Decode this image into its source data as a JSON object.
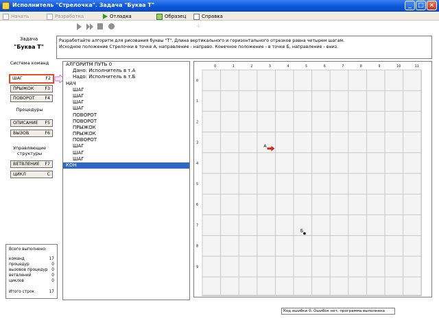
{
  "window": {
    "title": "Исполнитель \"Стрелочка\". Задача \"Буква Т\"",
    "controls": [
      "_",
      "□",
      "×"
    ]
  },
  "menu": [
    {
      "label": "Начать",
      "icon": "doc-icon",
      "enabled": false
    },
    {
      "label": "Разработка",
      "icon": "page-icon",
      "enabled": false
    },
    {
      "label": "Отладка",
      "icon": "play-icon",
      "enabled": true
    },
    {
      "label": "Образец",
      "icon": "sample-icon",
      "enabled": true
    },
    {
      "label": "Справка",
      "icon": "help-icon",
      "enabled": true
    }
  ],
  "task": {
    "heading": "Задача",
    "name": "\"Буква Т\"",
    "description_lines": [
      "Разработайте алгоритм для рисования буквы \"Т\". Длина вертикального и горизонтального отрезков равна четырем шагам.",
      "Исходное положение Стрелочки в точке А, направление - направо. Конечное положение - в точке Б, направление - вниз."
    ]
  },
  "commands": {
    "group_simple": "Система команд",
    "group_procedures": "Процедуры",
    "group_structures": "Управляющие структуры",
    "buttons": [
      {
        "label": "ШАГ",
        "key": "F2",
        "selected": true
      },
      {
        "label": "ПРЫЖОК",
        "key": "F3",
        "selected": false
      },
      {
        "label": "ПОВОРОТ",
        "key": "F4",
        "selected": false
      },
      {
        "label": "ОПИСАНИЕ",
        "key": "F5",
        "selected": false
      },
      {
        "label": "ВЫЗОВ",
        "key": "F6",
        "selected": false
      },
      {
        "label": "ВЕТВЛЕНИЕ",
        "key": "F7",
        "selected": false
      },
      {
        "label": "ЦИКЛ",
        "key": "C",
        "selected": false
      }
    ]
  },
  "stats": {
    "heading": "Всего выполнено:",
    "rows": [
      {
        "label": "команд",
        "value": "17"
      },
      {
        "label": "процедур",
        "value": "0"
      },
      {
        "label": "вызовов процедур",
        "value": "0"
      },
      {
        "label": "ветвлений",
        "value": "0"
      },
      {
        "label": "циклов",
        "value": "0"
      }
    ],
    "total_label": "Итого строк",
    "total_value": "17"
  },
  "program": {
    "lines": [
      {
        "text": "АЛГОРИТМ ПУТЬ 0",
        "indent": 0
      },
      {
        "text": "Дано: Исполнитель в т.А",
        "indent": 1
      },
      {
        "text": "Надо: Исполнитель в т.Б",
        "indent": 1
      },
      {
        "text": "НАЧ",
        "indent": 0
      },
      {
        "text": "ШАГ",
        "indent": 1
      },
      {
        "text": "ШАГ",
        "indent": 1
      },
      {
        "text": "ШАГ",
        "indent": 1
      },
      {
        "text": "ШАГ",
        "indent": 1
      },
      {
        "text": "ПОВОРОТ",
        "indent": 1
      },
      {
        "text": "ПОВОРОТ",
        "indent": 1
      },
      {
        "text": "ПРЫЖОК",
        "indent": 1
      },
      {
        "text": "ПРЫЖОК",
        "indent": 1
      },
      {
        "text": "ПОВОРОТ",
        "indent": 1
      },
      {
        "text": "ШАГ",
        "indent": 1
      },
      {
        "text": "ШАГ",
        "indent": 1
      },
      {
        "text": "ШАГ",
        "indent": 1
      },
      {
        "text": "КОН",
        "indent": 0,
        "selected": true
      }
    ]
  },
  "field": {
    "columns": [
      "0",
      "1",
      "2",
      "3",
      "4",
      "5",
      "6",
      "7",
      "8",
      "9",
      "10",
      "11"
    ],
    "rows": [
      "0",
      "1",
      "2",
      "3",
      "4",
      "5",
      "6",
      "7",
      "8",
      "9"
    ],
    "point_a": {
      "label": "А",
      "col": 3.7,
      "row": 3.8
    },
    "point_b": {
      "label": "Б",
      "col": 5.6,
      "row": 7.9
    },
    "arrow_direction": "right",
    "colors": {
      "grid": "#c8c8c8",
      "arrow": "#d8221a",
      "background": "#f4f4f4"
    }
  },
  "statusbar": {
    "text": "Код ошибки 0: Ошибок нет, программа выполнена"
  }
}
